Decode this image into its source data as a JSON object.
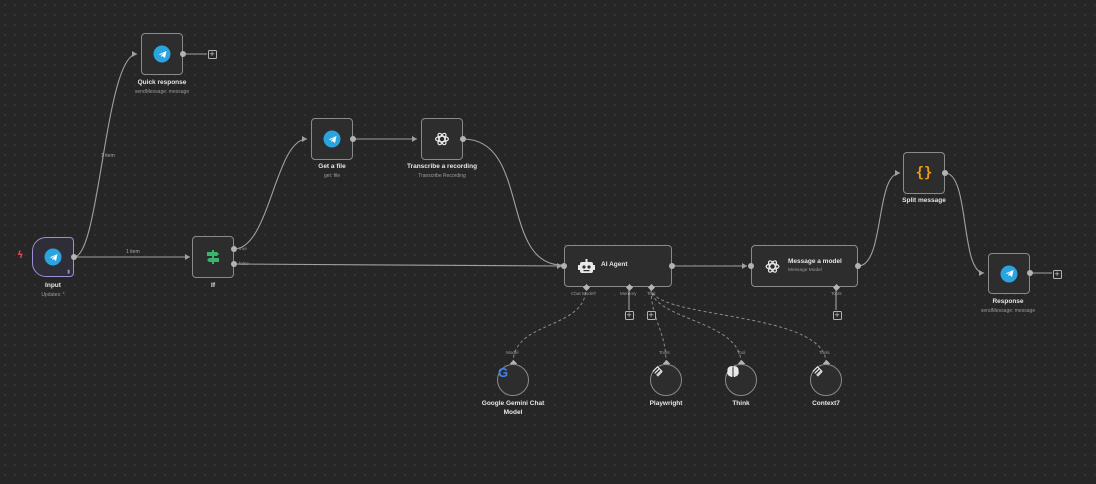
{
  "nodes": {
    "input": {
      "title": "Input",
      "subtitle": "Updates: *",
      "icon": "telegram-icon"
    },
    "quick_response": {
      "title": "Quick response",
      "subtitle": "sendMessage: message",
      "icon": "telegram-icon"
    },
    "if": {
      "title": "If",
      "icon": "if-signpost-icon",
      "out_true": "true",
      "out_false": "false"
    },
    "get_file": {
      "title": "Get a file",
      "subtitle": "get: file",
      "icon": "telegram-icon"
    },
    "transcribe": {
      "title": "Transcribe a recording",
      "subtitle": "Transcribe Recording",
      "icon": "openai-icon"
    },
    "ai_agent": {
      "title": "AI Agent",
      "icon": "robot-icon",
      "port_chat_model": "Chat Model*",
      "port_memory": "Memory",
      "port_tool": "Tool"
    },
    "message_model": {
      "title": "Message a model",
      "subtitle": "Message Model",
      "icon": "openai-icon",
      "port_tools": "Tools"
    },
    "split_message": {
      "title": "Split message",
      "icon": "code-braces-icon",
      "glyph": "{}"
    },
    "response": {
      "title": "Response",
      "subtitle": "sendMessage: message",
      "icon": "telegram-icon"
    },
    "gemini": {
      "title_line1": "Google Gemini Chat",
      "title_line2": "Model",
      "port": "Model",
      "icon": "google-icon",
      "glyph": "G"
    },
    "playwright": {
      "title": "Playwright",
      "port": "Tools",
      "icon": "mcp-icon"
    },
    "think": {
      "title": "Think",
      "port": "Tool",
      "icon": "brain-icon"
    },
    "context7": {
      "title": "Context7",
      "port": "Tools",
      "icon": "mcp-icon"
    }
  },
  "edge_labels": {
    "input_to_quick": "1 item",
    "input_to_if": "1 item"
  },
  "colors": {
    "canvas": "#262626",
    "node_border": "#8a8a8a",
    "edge": "#a0a0a0",
    "telegram": "#2aa4df",
    "if_green": "#3bb46e",
    "code_orange": "#f39c12",
    "trigger_border": "#9b8fd6",
    "bolt": "#e0464a"
  }
}
